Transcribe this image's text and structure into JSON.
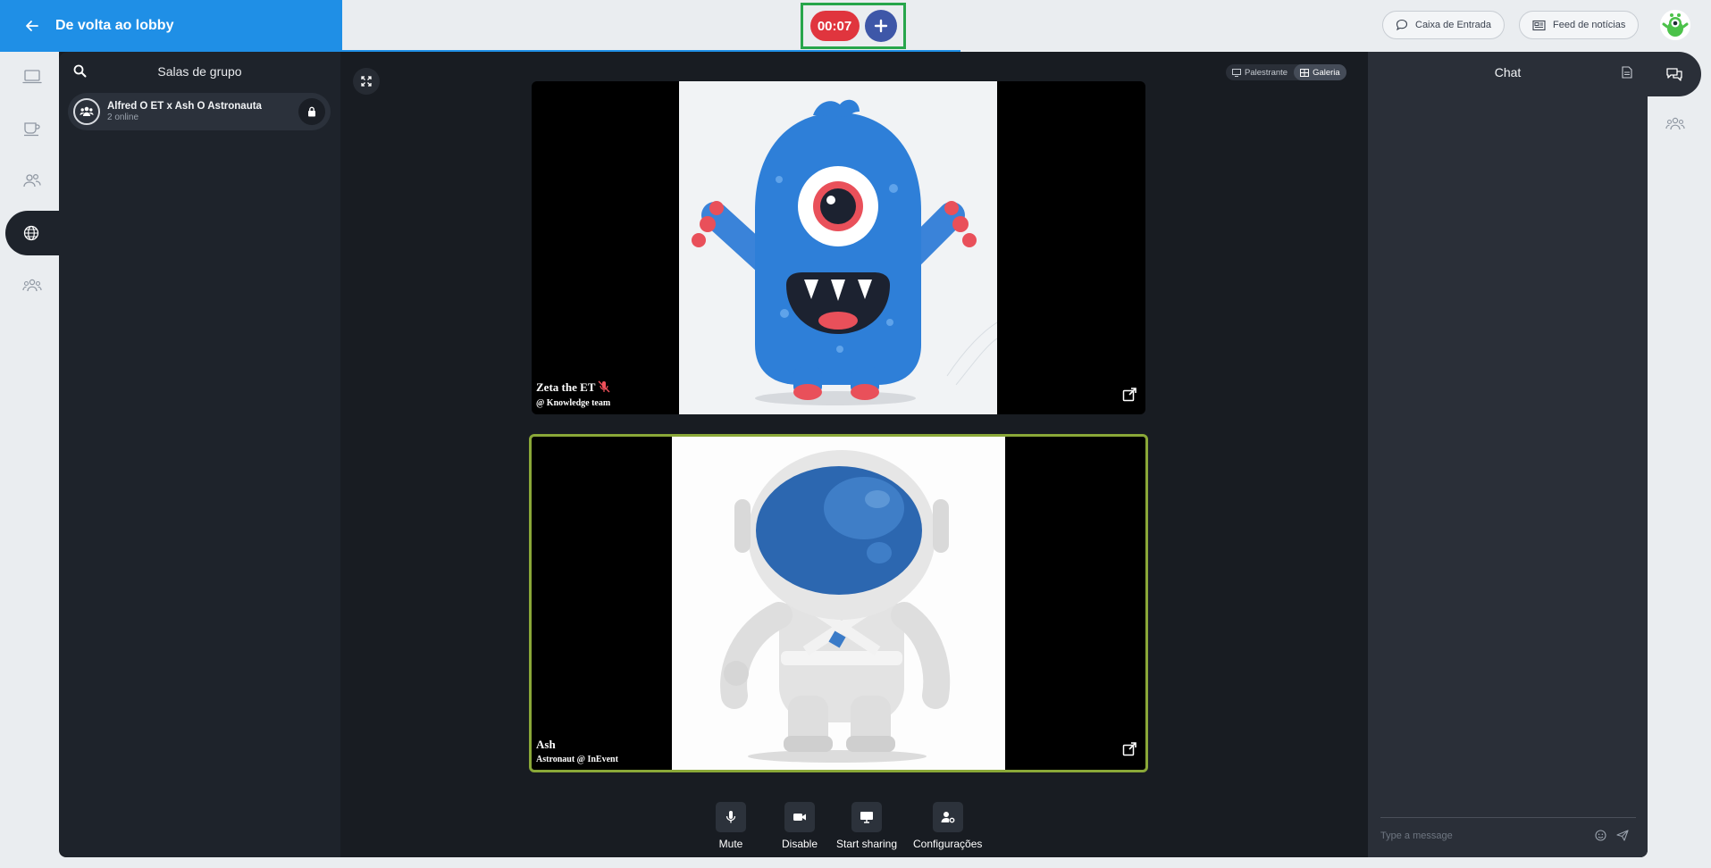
{
  "header": {
    "back_label": "De volta ao lobby",
    "timer": "00:07",
    "inbox_label": "Caixa de Entrada",
    "feed_label": "Feed de notícias"
  },
  "groups": {
    "title": "Salas de grupo",
    "rooms": [
      {
        "name": "Alfred O ET x Ash O Astronauta",
        "status": "2 online"
      }
    ]
  },
  "stage": {
    "view_speaker": "Palestrante",
    "view_gallery": "Galeria",
    "participants": [
      {
        "name": "Zeta the ET",
        "subtitle": "@ Knowledge team",
        "muted": true
      },
      {
        "name": "Ash",
        "subtitle": "Astronaut @ InEvent",
        "muted": false,
        "speaking": true
      }
    ],
    "controls": {
      "mute": "Mute",
      "disable": "Disable",
      "share": "Start sharing",
      "settings": "Configurações"
    }
  },
  "chat": {
    "title": "Chat",
    "placeholder": "Type a message"
  },
  "colors": {
    "brand_blue": "#1f8fe6",
    "timer_red": "#e0353e",
    "plus_blue": "#3e57a8",
    "highlight_green": "#27a64b",
    "speaking_border": "#8aa838"
  }
}
